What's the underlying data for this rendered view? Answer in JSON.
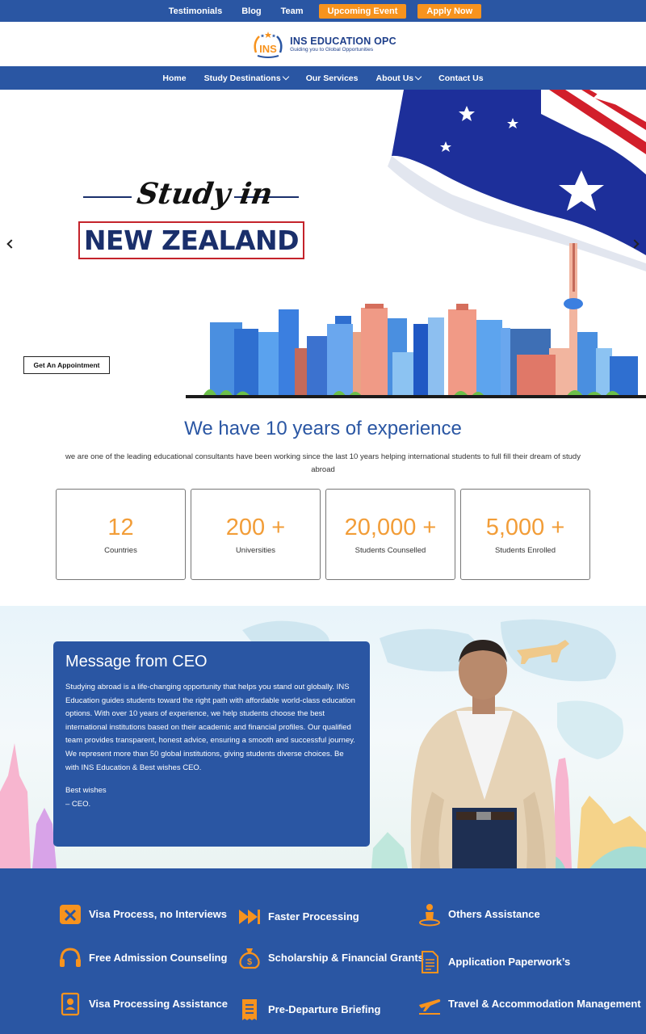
{
  "topbar": {
    "links": [
      "Testimonials",
      "Blog",
      "Team"
    ],
    "buttons": [
      "Upcoming Event",
      "Apply Now"
    ]
  },
  "logo": {
    "mark_text": "INS",
    "name": "INS EDUCATION OPC",
    "tagline": "Guiding you to Global Opportunities"
  },
  "nav": {
    "items": [
      "Home",
      "Study Destinations",
      "Our Services",
      "About Us",
      "Contact Us"
    ]
  },
  "hero": {
    "script_title": "Study in",
    "country": "NEW ZEALAND",
    "cta": "Get An Appointment"
  },
  "experience": {
    "title": "We have 10 years of experience",
    "description": "we are one of the leading educational consultants have been working since the last 10 years helping international students to full fill their dream of study abroad",
    "stats": [
      {
        "value": "12",
        "label": "Countries"
      },
      {
        "value": "200 +",
        "label": "Universities"
      },
      {
        "value": "20,000 +",
        "label": "Students Counselled"
      },
      {
        "value": "5,000 +",
        "label": "Students Enrolled"
      }
    ]
  },
  "ceo": {
    "title": "Message from CEO",
    "body": "Studying abroad is a life-changing opportunity that helps you stand out globally. INS Education guides students toward the right path with affordable world-class education options. With over 10 years of experience, we help students choose the best international institutions based on their academic and financial profiles. Our qualified team provides transparent, honest advice, ensuring a smooth and successful journey. We represent more than 50 global institutions, giving students diverse choices. Be with INS Education & Best wishes CEO.",
    "signoff_1": "Best wishes",
    "signoff_2": "– CEO."
  },
  "services": {
    "items": [
      "Visa Process, no Interviews",
      "Faster Processing",
      "Others Assistance",
      "Free Admission Counseling",
      "Scholarship & Financial Grants",
      "Application Paperwork’s",
      "Visa Processing Assistance",
      "Pre-Departure Briefing",
      "Travel & Accommodation Management"
    ],
    "icon_color": "#f7931e"
  },
  "colors": {
    "brand_blue": "#2a56a3",
    "accent_orange": "#f7931e",
    "stat_orange": "#f29d38"
  }
}
